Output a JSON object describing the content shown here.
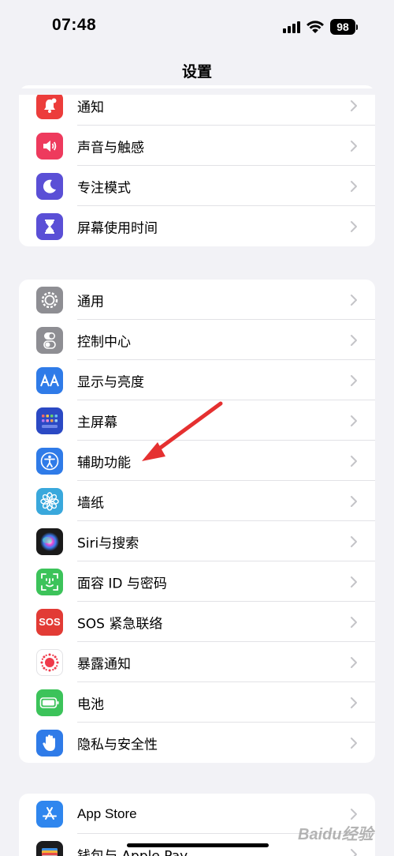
{
  "status_bar": {
    "time": "07:48",
    "battery": "98"
  },
  "nav": {
    "title": "设置"
  },
  "groups": [
    {
      "items": [
        {
          "label": "通知",
          "icon": "bell-badge-icon",
          "color": "#ec3d3b"
        },
        {
          "label": "声音与触感",
          "icon": "speaker-icon",
          "color": "#ee3a5d"
        },
        {
          "label": "专注模式",
          "icon": "moon-icon",
          "color": "#5a4fd6"
        },
        {
          "label": "屏幕使用时间",
          "icon": "hourglass-icon",
          "color": "#5a4fd6"
        }
      ]
    },
    {
      "items": [
        {
          "label": "通用",
          "icon": "gear-icon",
          "color": "#8e8e93"
        },
        {
          "label": "控制中心",
          "icon": "toggles-icon",
          "color": "#8e8e93"
        },
        {
          "label": "显示与亮度",
          "icon": "text-size-icon",
          "color": "#2f7be8"
        },
        {
          "label": "主屏幕",
          "icon": "home-grid-icon",
          "color": "#2b49c4"
        },
        {
          "label": "辅助功能",
          "icon": "accessibility-icon",
          "color": "#2f7be8"
        },
        {
          "label": "墙纸",
          "icon": "flower-icon",
          "color": "#39a8dc"
        },
        {
          "label": "Siri与搜索",
          "icon": "siri-icon",
          "color": "#1a1a1a"
        },
        {
          "label": "面容 ID 与密码",
          "icon": "face-id-icon",
          "color": "#3cc35a"
        },
        {
          "label": "SOS 紧急联络",
          "icon": "sos-icon",
          "color": "#e23b35",
          "icon_text": "SOS"
        },
        {
          "label": "暴露通知",
          "icon": "exposure-icon",
          "color": "#ffffff"
        },
        {
          "label": "电池",
          "icon": "battery-icon",
          "color": "#3cc35a"
        },
        {
          "label": "隐私与安全性",
          "icon": "hand-icon",
          "color": "#2f7be8"
        }
      ]
    },
    {
      "items": [
        {
          "label": "App Store",
          "icon": "app-store-icon",
          "color": "#2f86ee"
        },
        {
          "label": "钱包与 Apple Pay",
          "icon": "wallet-icon",
          "color": "#1c1c1e"
        }
      ]
    }
  ],
  "watermark": "Baidu经验"
}
